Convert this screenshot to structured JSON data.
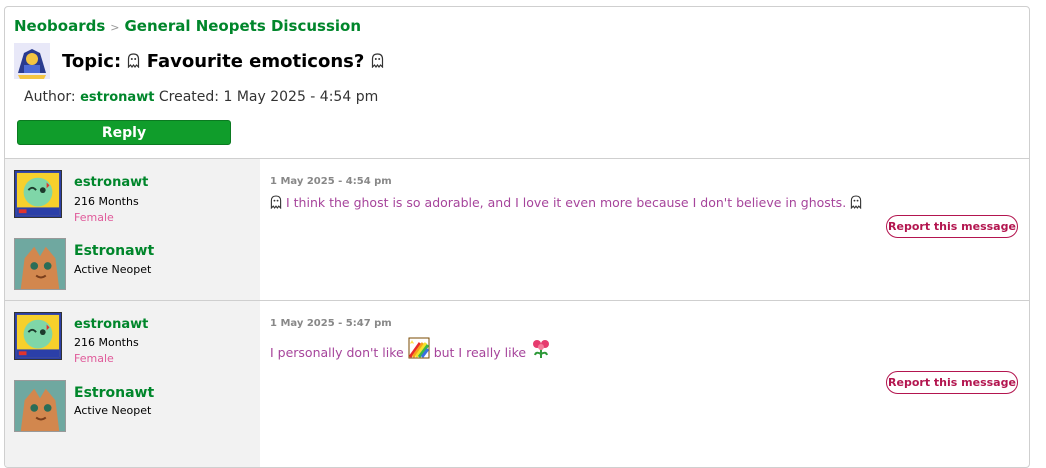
{
  "breadcrumb": {
    "root": "Neoboards",
    "separator": ">",
    "board": "General Neopets Discussion"
  },
  "topic": {
    "prefix": "Topic:",
    "title": "Favourite emoticons?",
    "author_label": "Author:",
    "author": "estronawt",
    "created_label": "Created:",
    "created": "1 May 2025 - 4:54 pm",
    "reply_label": "Reply"
  },
  "posts": [
    {
      "username": "estronawt",
      "months": "216 Months",
      "gender": "Female",
      "pet_name": "Estronawt",
      "pet_status": "Active Neopet",
      "timestamp": "1 May 2025 - 4:54 pm",
      "message": "I think the ghost is so adorable, and I love it even more because I don't believe in ghosts.",
      "report_label": "Report this message"
    },
    {
      "username": "estronawt",
      "months": "216 Months",
      "gender": "Female",
      "pet_name": "Estronawt",
      "pet_status": "Active Neopet",
      "timestamp": "1 May 2025 - 5:47 pm",
      "message_part1": "I personally don't like",
      "message_part2": "but I really like",
      "report_label": "Report this message"
    }
  ],
  "colors": {
    "link_green": "#00862b",
    "reply_green": "#109d2b",
    "message_pink": "#a6449b",
    "report_red": "#b3154f"
  }
}
